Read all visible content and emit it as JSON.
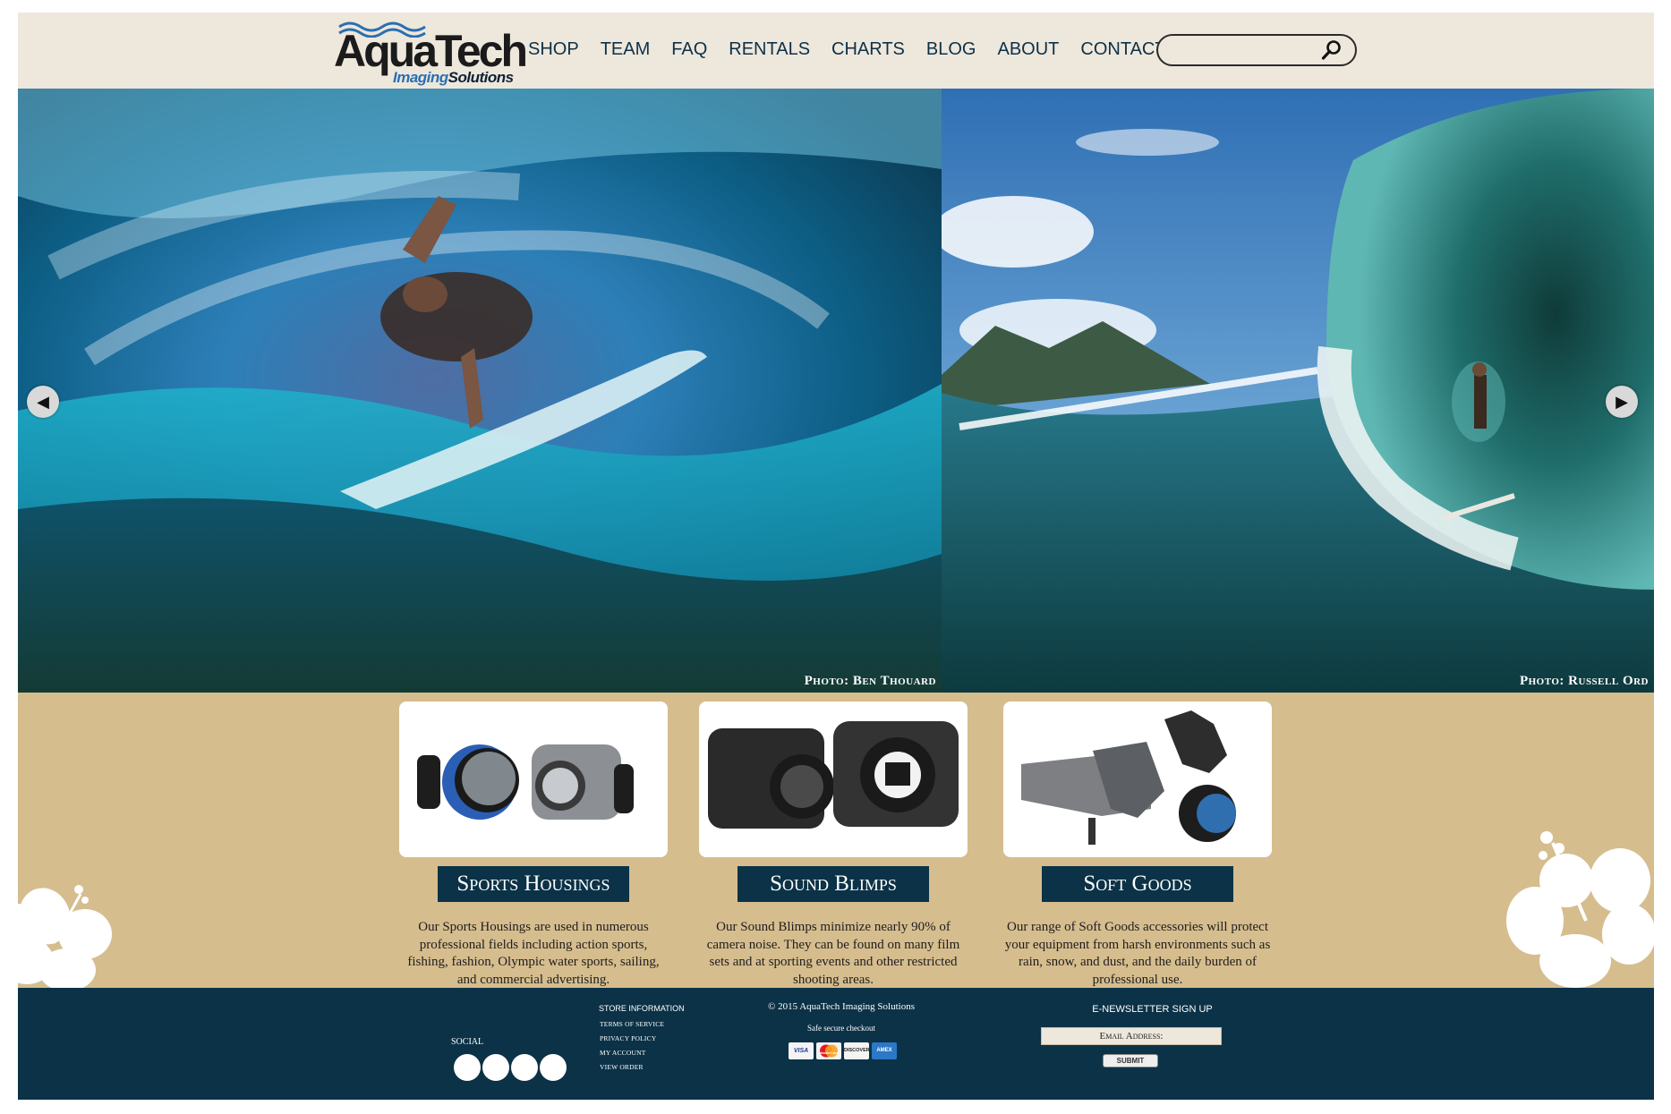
{
  "header": {
    "logo": {
      "name": "AquaTech",
      "sub_italic": "Imaging",
      "sub_rest": "Solutions"
    },
    "nav": [
      "SHOP",
      "TEAM",
      "FAQ",
      "RENTALS",
      "CHARTS",
      "BLOG",
      "ABOUT",
      "CONTACT"
    ],
    "search": {
      "placeholder": "",
      "icon": "search-icon"
    }
  },
  "hero": {
    "left_credit": "Photo: Ben Thouard",
    "right_credit": "Photo: Russell Ord",
    "prev_icon": "◀",
    "next_icon": "▶"
  },
  "categories": [
    {
      "title": "Sports Housings",
      "description": "Our Sports Housings are used in numerous professional fields including action sports, fishing, fashion, Olympic water sports, sailing, and commercial advertising."
    },
    {
      "title": "Sound Blimps",
      "description": "Our Sound Blimps minimize nearly 90% of camera noise. They can be found on many film sets and at sporting events and other restricted shooting areas."
    },
    {
      "title": "Soft Goods",
      "description": "Our range of Soft Goods accessories will protect your equipment from harsh environments such as rain, snow, and dust, and the daily burden of professional use."
    }
  ],
  "footer": {
    "social_label": "SOCIAL",
    "store_title": "STORE INFORMATION",
    "store_links": [
      "TERMS OF SERVICE",
      "PRIVACY POLICY",
      "MY ACCOUNT",
      "VIEW ORDER"
    ],
    "copyright": "© 2015 AquaTech Imaging Solutions",
    "secure": "Safe secure checkout",
    "cards": [
      "VISA",
      "MasterCard",
      "DISCOVER",
      "AMEX"
    ],
    "newsletter_title": "E-NEWSLETTER SIGN UP",
    "email_placeholder": "Email Address:",
    "submit_label": "SUBMIT"
  },
  "colors": {
    "header_bg": "#eee7dc",
    "nav_text": "#0d3147",
    "band_bg": "#d6bd8e",
    "footer_bg": "#0b3247",
    "button_bg": "#0b3247"
  }
}
